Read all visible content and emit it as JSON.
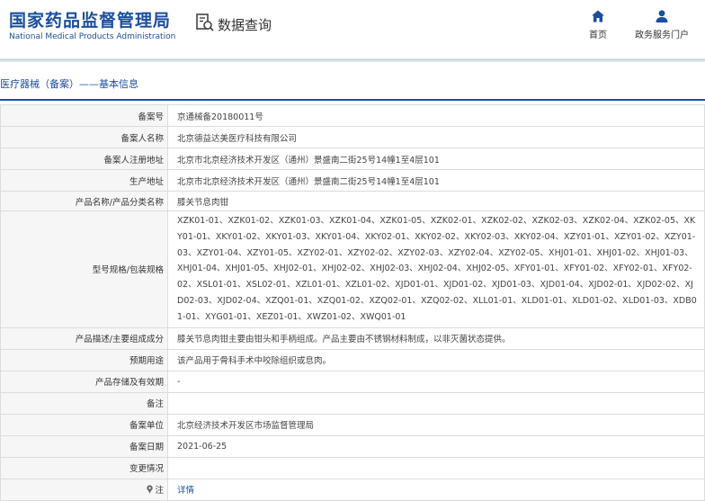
{
  "header": {
    "logo_cn": "国家药品监督管理局",
    "logo_en": "National Medical Products Administration",
    "query_label": "数据查询",
    "nav": [
      {
        "label": "首页",
        "icon": "home-icon"
      },
      {
        "label": "政务服务门户",
        "icon": "user-icon"
      }
    ],
    "brand_color": "#1a4f9c"
  },
  "breadcrumb": "医疗器械（备案）——基本信息",
  "rows": [
    {
      "label": "备案号",
      "value": "京通械备20180011号"
    },
    {
      "label": "备案人名称",
      "value": "北京德益达美医疗科技有限公司"
    },
    {
      "label": "备案人注册地址",
      "value": "北京市北京经济技术开发区（通州）景盛南二街25号14幢1至4层101"
    },
    {
      "label": "生产地址",
      "value": "北京市北京经济技术开发区（通州）景盛南二街25号14幢1至4层101"
    },
    {
      "label": "产品名称/产品分类名称",
      "value": "膝关节息肉钳"
    },
    {
      "label": "型号规格/包装规格",
      "value": "XZK01-01、XZK01-02、XZK01-03、XZK01-04、XZK01-05、XZK02-01、XZK02-02、XZK02-03、XZK02-04、XZK02-05、XKY01-01、XKY01-02、XKY01-03、XKY01-04、XKY02-01、XKY02-02、XKY02-03、XKY02-04、XZY01-01、XZY01-02、XZY01-03、XZY01-04、XZY01-05、XZY02-01、XZY02-02、XZY02-03、XZY02-04、XZY02-05、XHJ01-01、XHJ01-02、XHJ01-03、XHJ01-04、XHJ01-05、XHJ02-01、XHJ02-02、XHJ02-03、XHJ02-04、XHJ02-05、XFY01-01、XFY01-02、XFY02-01、XFY02-02、XSL01-01、XSL02-01、XZL01-01、XZL01-02、XJD01-01、XJD01-02、XJD01-03、XJD01-04、XJD02-01、XJD02-02、XJD02-03、XJD02-04、XZQ01-01、XZQ01-02、XZQ02-01、XZQ02-02、XLL01-01、XLD01-01、XLD01-02、XLD01-03、XDB01-01、XYG01-01、XEZ01-01、XWZ01-02、XWQ01-01",
      "multi": true
    },
    {
      "label": "产品描述/主要组成成分",
      "value": "膝关节息肉钳主要由钳头和手柄组成。产品主要由不锈钢材料制成，以非灭菌状态提供。"
    },
    {
      "label": "预期用途",
      "value": "该产品用于骨科手术中咬除组织或息肉。"
    },
    {
      "label": "产品存储及有效期",
      "value": "-"
    },
    {
      "label": "备注",
      "value": ""
    },
    {
      "label": "备案单位",
      "value": "北京经济技术开发区市场监督管理局"
    },
    {
      "label": "备案日期",
      "value": "2021-06-25"
    },
    {
      "label": "变更情况",
      "value": ""
    },
    {
      "label": "注",
      "value": "详情",
      "icon": "pin-icon",
      "link": true
    }
  ]
}
